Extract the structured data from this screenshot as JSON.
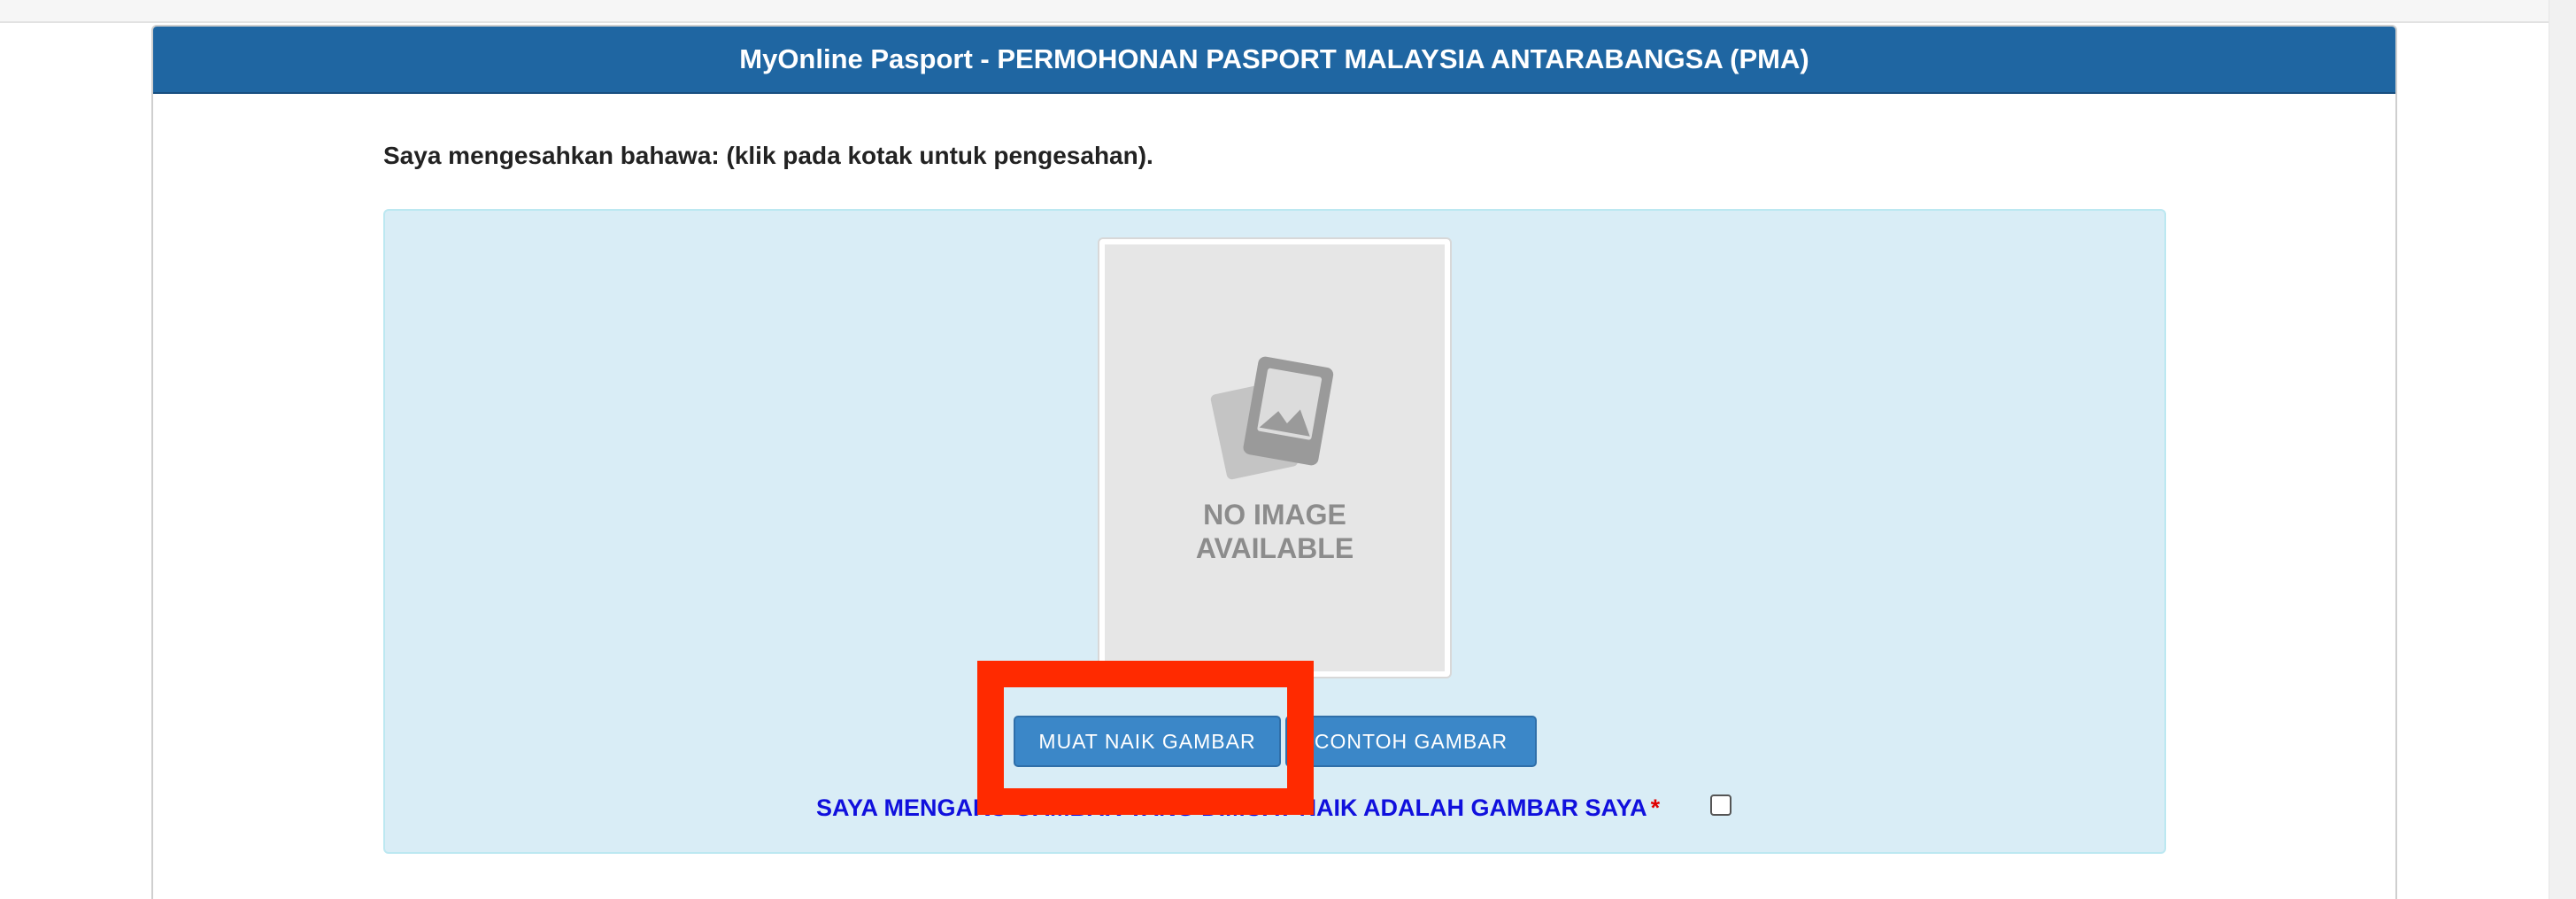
{
  "panel": {
    "title": "MyOnline Pasport - PERMOHONAN PASPORT MALAYSIA ANTARABANGSA (PMA)"
  },
  "confirm_text": "Saya mengesahkan bahawa: (klik pada kotak untuk pengesahan).",
  "photo": {
    "placeholder_icon": "no-image-icon",
    "placeholder_line1": "NO IMAGE",
    "placeholder_line2": "AVAILABLE"
  },
  "buttons": {
    "upload_label": "MUAT NAIK GAMBAR",
    "sample_label": "CONTOH GAMBAR"
  },
  "declaration": {
    "text": "SAYA MENGAKU GAMBAR YANG DIMUAT NAIK ADALAH GAMBAR SAYA",
    "required_mark": "*",
    "checked": false
  },
  "colors": {
    "header_bg": "#1f66a2",
    "info_box_bg": "#d9edf6",
    "button_bg": "#3b87c8",
    "declaration_text": "#1010dd",
    "highlight": "#ff2a00"
  }
}
